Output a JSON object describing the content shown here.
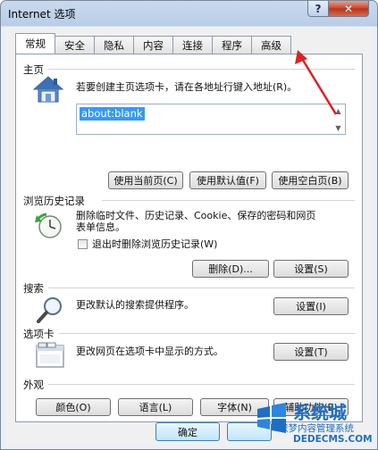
{
  "window": {
    "title": "Internet 选项",
    "help_label": "?",
    "close_label": "✕"
  },
  "tabs": [
    {
      "label": "常规",
      "active": true
    },
    {
      "label": "安全",
      "active": false
    },
    {
      "label": "隐私",
      "active": false
    },
    {
      "label": "内容",
      "active": false
    },
    {
      "label": "连接",
      "active": false
    },
    {
      "label": "程序",
      "active": false
    },
    {
      "label": "高级",
      "active": false
    }
  ],
  "homepage": {
    "title": "主页",
    "description": "若要创建主页选项卡，请在各地址行键入地址(R)。",
    "url": "about:blank",
    "use_current": "使用当前页(C)",
    "use_default": "使用默认值(F)",
    "use_blank": "使用空白页(B)"
  },
  "history": {
    "title": "浏览历史记录",
    "description_line1": "删除临时文件、历史记录、Cookie、保存的密码和网页",
    "description_line2": "表单信息。",
    "checkbox_label": "退出时删除浏览历史记录(W)",
    "checkbox_checked": false,
    "delete_button": "删除(D)...",
    "settings_button": "设置(S)"
  },
  "search": {
    "title": "搜索",
    "description": "更改默认的搜索提供程序。",
    "settings_button": "设置(I)"
  },
  "tabs_section": {
    "title": "选项卡",
    "description": "更改网页在选项卡中显示的方式。",
    "settings_button": "设置(T)"
  },
  "appearance": {
    "title": "外观",
    "colors": "颜色(O)",
    "languages": "语言(L)",
    "fonts": "字体(N)",
    "accessibility": "辅助功能(E)"
  },
  "footer": {
    "ok": "确定"
  },
  "watermark": {
    "line1": "系统城",
    "line2": "织梦内容管理系统",
    "line3": "DEDECMS.COM"
  },
  "colors": {
    "annotation_arrow": "#e02020",
    "selection": "#3399ff",
    "watermark": "#1d6fc4"
  }
}
